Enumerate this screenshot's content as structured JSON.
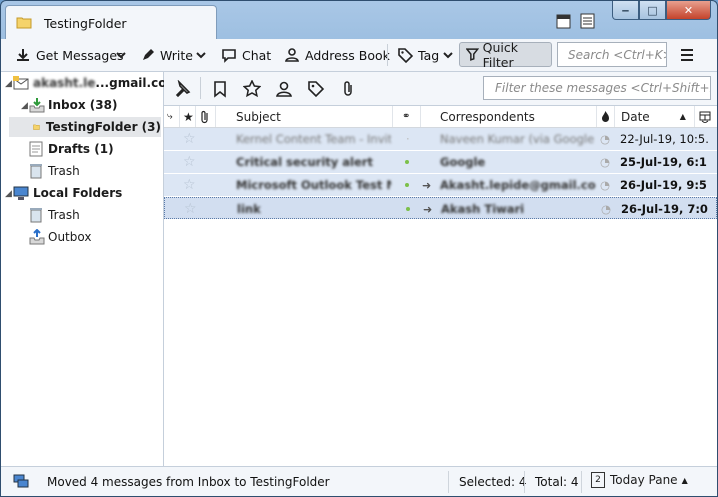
{
  "window": {
    "tab_title": "TestingFolder",
    "controls": {
      "minimize": "‒",
      "maximize": "□",
      "close": "✕"
    }
  },
  "toolbar": {
    "get_messages": "Get Messages",
    "write": "Write",
    "chat": "Chat",
    "address_book": "Address Book",
    "tag": "Tag",
    "quick_filter": "Quick Filter",
    "search_placeholder": "Search <Ctrl+K>"
  },
  "sidebar": {
    "account_prefix": "akasht.le",
    "account_suffix": "...gmail.com",
    "inbox": "Inbox (38)",
    "testing_folder": "TestingFolder (3)",
    "drafts": "Drafts (1)",
    "trash": "Trash",
    "local_folders": "Local Folders",
    "local_trash": "Trash",
    "outbox": "Outbox"
  },
  "filter": {
    "placeholder": "Filter these messages <Ctrl+Shift+K>"
  },
  "columns": {
    "subject": "Subject",
    "correspondents": "Correspondents",
    "date": "Date"
  },
  "messages": [
    {
      "subject": "Kernel Content Team - Invita...",
      "correspondent": "Naveen Kumar (via Google ...",
      "date": "22-Jul-19, 10:5..."
    },
    {
      "subject": "Critical security alert",
      "correspondent": "Google",
      "date": "25-Jul-19, 6:1..."
    },
    {
      "subject": "Microsoft Outlook Test Me...",
      "correspondent": "Akasht.lepide@gmail.com",
      "date": "26-Jul-19, 9:5..."
    },
    {
      "subject": "link",
      "correspondent": "Akash  Tiwari",
      "date": "26-Jul-19, 7:0..."
    }
  ],
  "status": {
    "message": "Moved 4 messages from Inbox to TestingFolder",
    "selected": "Selected: 4",
    "total": "Total: 4",
    "today_pane": "Today Pane",
    "today_pane_day": "2"
  }
}
